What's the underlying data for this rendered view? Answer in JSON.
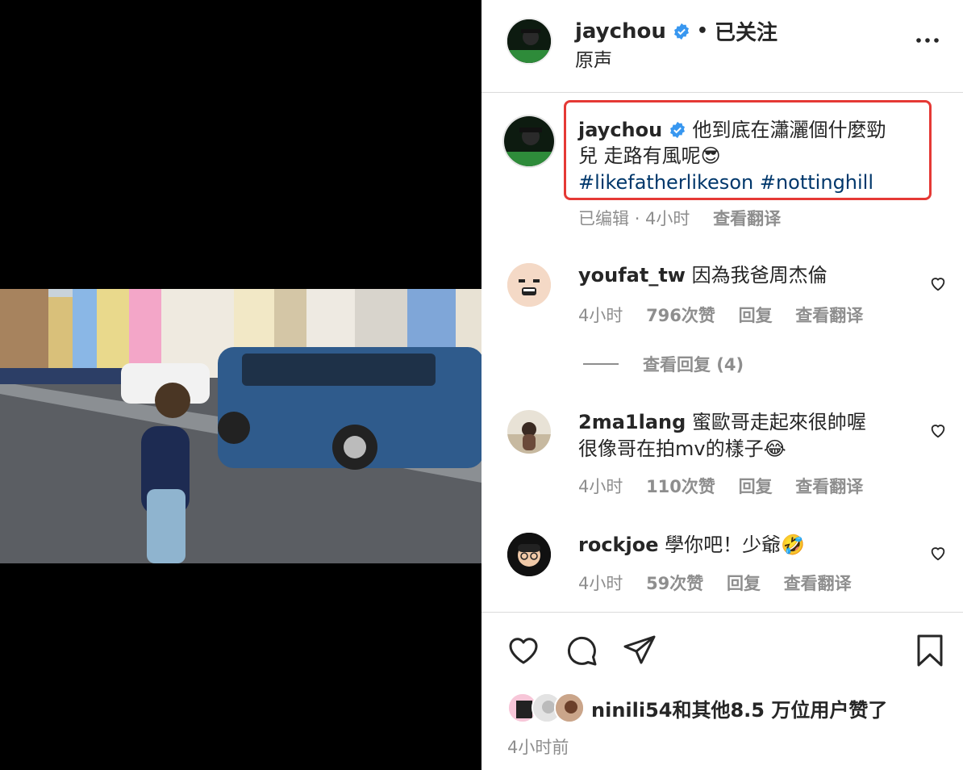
{
  "post": {
    "username": "jaychou",
    "follow_status": "已关注",
    "audio": "原声",
    "caption_line1": "他到底在瀟灑個什麼勁",
    "caption_line2": "兒 走路有風呢😎",
    "hashtags": [
      "#likefatherlikeson",
      "#nottinghill"
    ],
    "edited": "已编辑",
    "time": "4小时",
    "translate": "查看翻译"
  },
  "comments": [
    {
      "user": "youfat_tw",
      "text": "因為我爸周杰倫",
      "time": "4小时",
      "likes": "796次赞",
      "reply": "回复",
      "translate": "查看翻译",
      "view_replies": "查看回复 (4)"
    },
    {
      "user": "2ma1lang",
      "text": "蜜歐哥走起來很帥喔",
      "text2": "很像哥在拍mv的樣子😂",
      "time": "4小时",
      "likes": "110次赞",
      "reply": "回复",
      "translate": "查看翻译"
    },
    {
      "user": "rockjoe",
      "text": "學你吧！少爺🤣",
      "time": "4小时",
      "likes": "59次赞",
      "reply": "回复",
      "translate": "查看翻译"
    }
  ],
  "footer": {
    "likes_text": "ninili54和其他8.5 万位用户赞了",
    "posted": "4小时前"
  },
  "icons": [
    "verified-badge-icon",
    "more-icon",
    "heart-icon",
    "comment-icon",
    "share-icon",
    "bookmark-icon"
  ],
  "colors": {
    "verified": "#3897f0",
    "hashtag": "#00376b",
    "highlight_box": "#e53935",
    "muted": "#8e8e8e"
  }
}
